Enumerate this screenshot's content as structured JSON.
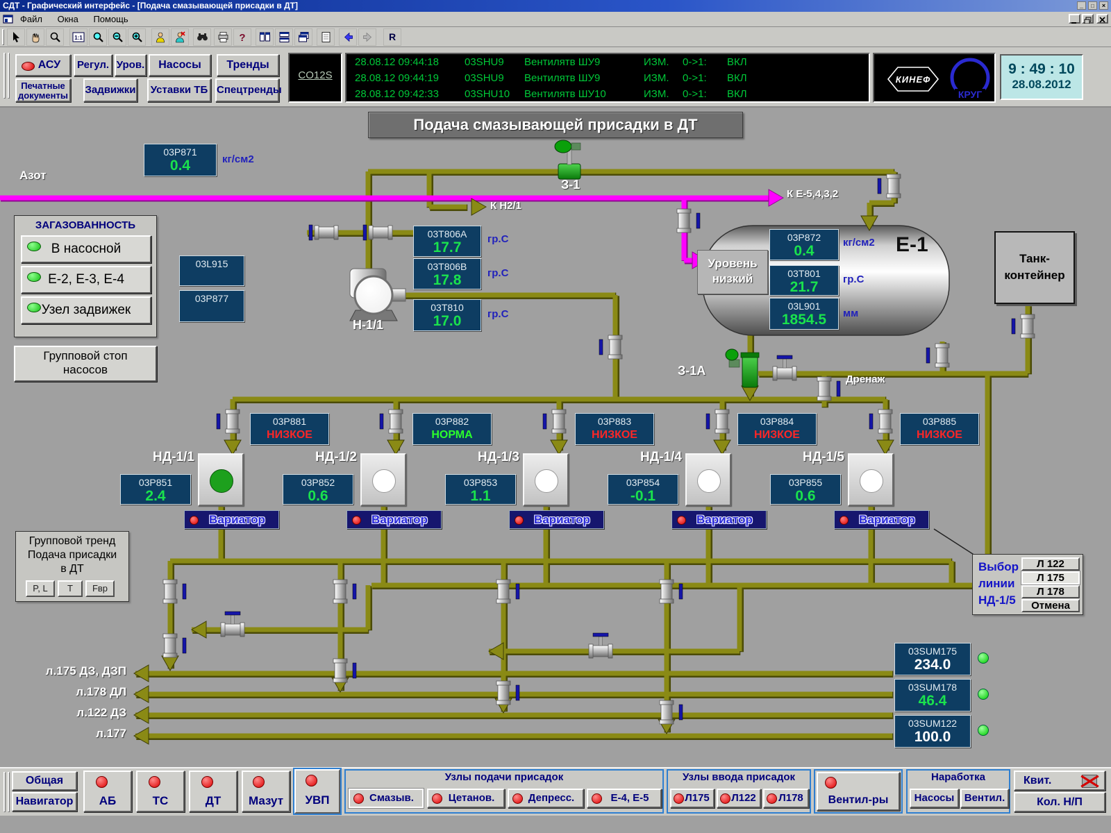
{
  "colors": {
    "display_navy": "#0e3d62",
    "value_green": "#1ae24d",
    "alarm_red": "#ff2626",
    "norm_green": "#2cff2c",
    "pipe_olive": "#8a8a15",
    "nitrogen_magenta": "#ff00ff",
    "button_text_blue": "#00007c"
  },
  "window": {
    "title": "СДТ - Графический интерфейс - [Подача смазывающей присадки в ДТ]"
  },
  "menu": {
    "file": "Файл",
    "windows": "Окна",
    "help": "Помощь"
  },
  "toolbar": {
    "one_to_one": "1:1",
    "r": "R"
  },
  "header": {
    "asu": "АСУ",
    "regul": "Регул.",
    "urov": "Уров.",
    "nasosy": "Насосы",
    "trendy": "Тренды",
    "pechat": "Печатные\nдокументы",
    "zadvizhki": "Задвижки",
    "ustavki": "Уставки ТБ",
    "spectrendy": "Спецтренды",
    "co12s": "CO12S",
    "alarms": [
      {
        "dt": "28.08.12 09:44:18",
        "tag": "03SHU9",
        "desc": "Вентилятв ШУ9",
        "typ": "ИЗМ.",
        "chg": "0->1:",
        "st": "ВКЛ"
      },
      {
        "dt": "28.08.12 09:44:19",
        "tag": "03SHU9",
        "desc": "Вентилятв ШУ9",
        "typ": "ИЗМ.",
        "chg": "0->1:",
        "st": "ВКЛ"
      },
      {
        "dt": "28.08.12 09:42:33",
        "tag": "03SHU10",
        "desc": "Вентилятв ШУ10",
        "typ": "ИЗМ.",
        "chg": "0->1:",
        "st": "ВКЛ"
      }
    ],
    "logo_kinef": "КИНЕФ",
    "logo_krug": "КРУГ",
    "time": "9 : 49 : 10",
    "date": "28.08.2012"
  },
  "mimic": {
    "title": "Подача смазывающей присадки в ДТ",
    "labels": {
      "azot": "Азот",
      "k_n21": "К Н2/1",
      "z1": "З-1",
      "k_e": "К Е-5,4,3,2",
      "e1": "Е-1",
      "uroven": "Уровень\nнизкий",
      "n11": "Н-1/1",
      "z1a": "З-1А",
      "drenazh": "Дренаж",
      "tank": "Танк-\nконтейнер",
      "l175": "л.175 ДЗ, ДЗП",
      "l178": "л.178 ДЛ",
      "l122": "л.122 ДЗ",
      "l177": "л.177"
    },
    "displays": {
      "p871": {
        "tag": "03P871",
        "value": "0.4",
        "unit": "кг/см2"
      },
      "l915": {
        "tag": "03L915"
      },
      "p877": {
        "tag": "03P877"
      },
      "t806a": {
        "tag": "03T806A",
        "value": "17.7",
        "unit": "гр.С"
      },
      "t806b": {
        "tag": "03T806B",
        "value": "17.8",
        "unit": "гр.С"
      },
      "t810": {
        "tag": "03T810",
        "value": "17.0",
        "unit": "гр.С"
      },
      "p872": {
        "tag": "03P872",
        "value": "0.4",
        "unit": "кг/см2"
      },
      "t801": {
        "tag": "03T801",
        "value": "21.7",
        "unit": "гр.С"
      },
      "l901": {
        "tag": "03L901",
        "value": "1854.5",
        "unit": "мм"
      },
      "sum175": {
        "tag": "03SUM175",
        "value": "234.0"
      },
      "sum178": {
        "tag": "03SUM178",
        "value": "46.4"
      },
      "sum122": {
        "tag": "03SUM122",
        "value": "100.0"
      }
    },
    "gas_panel": {
      "title": "ЗАГАЗОВАННОСТЬ",
      "b1": "В насосной",
      "b2": "Е-2, Е-3, Е-4",
      "b3": "Узел задвижек"
    },
    "group_stop": "Групповой стоп\nнасосов",
    "group_trend": {
      "line1": "Групповой тренд",
      "line2": "Подача присадки",
      "line3": "в ДТ",
      "b1": "P, L",
      "b2": "T",
      "b3": "Fвр"
    },
    "line_select": {
      "line1": "Выбор",
      "line2": "линии",
      "line3": "НД-1/5",
      "b1": "Л 122",
      "b2": "Л 175",
      "b3": "Л 178",
      "b4": "Отмена"
    },
    "pumps": [
      {
        "name": "НД-1/1",
        "alarm_tag": "03P881",
        "alarm": "НИЗКОЕ",
        "p_tag": "03P851",
        "p_value": "2.4",
        "variator": "Вариатор"
      },
      {
        "name": "НД-1/2",
        "alarm_tag": "03P882",
        "alarm": "НОРМА",
        "p_tag": "03P852",
        "p_value": "0.6",
        "variator": "Вариатор"
      },
      {
        "name": "НД-1/3",
        "alarm_tag": "03P883",
        "alarm": "НИЗКОЕ",
        "p_tag": "03P853",
        "p_value": "1.1",
        "variator": "Вариатор"
      },
      {
        "name": "НД-1/4",
        "alarm_tag": "03P884",
        "alarm": "НИЗКОЕ",
        "p_tag": "03P854",
        "p_value": "-0.1",
        "variator": "Вариатор"
      },
      {
        "name": "НД-1/5",
        "alarm_tag": "03P885",
        "alarm": "НИЗКОЕ",
        "p_tag": "03P855",
        "p_value": "0.6",
        "variator": "Вариатор"
      }
    ]
  },
  "bottom": {
    "obshchaya": "Общая",
    "navigator": "Навигатор",
    "ab": "АБ",
    "ts": "ТС",
    "dt": "ДТ",
    "mazut": "Мазут",
    "uvp": "УВП",
    "group_feed": {
      "title": "Узлы подачи присадок",
      "b1": "Смазыв.",
      "b2": "Цетанов.",
      "b3": "Депресс.",
      "b4": "Е-4, Е-5"
    },
    "group_input": {
      "title": "Узлы ввода присадок",
      "b1": "Л175",
      "b2": "Л122",
      "b3": "Л178"
    },
    "ventilatory": "Вентил-ры",
    "narabotka": {
      "title": "Наработка",
      "b1": "Насосы",
      "b2": "Вентил."
    },
    "kvit": "Квит.",
    "kol_np": "Кол. Н/П"
  }
}
